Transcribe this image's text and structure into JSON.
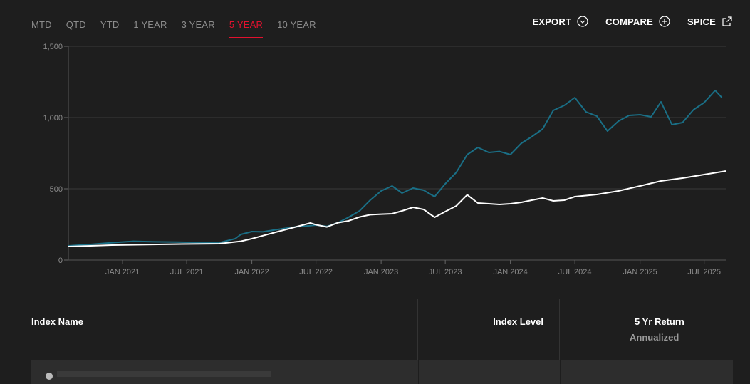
{
  "tabs": [
    {
      "label": "MTD",
      "active": false
    },
    {
      "label": "QTD",
      "active": false
    },
    {
      "label": "YTD",
      "active": false
    },
    {
      "label": "1 YEAR",
      "active": false
    },
    {
      "label": "3 YEAR",
      "active": false
    },
    {
      "label": "5 YEAR",
      "active": true
    },
    {
      "label": "10 YEAR",
      "active": false
    }
  ],
  "actions": {
    "export_label": "EXPORT",
    "export_icon": "chevron-down-circle-icon",
    "compare_label": "COMPARE",
    "compare_icon": "plus-circle-icon",
    "spice_label": "SPICE",
    "spice_icon": "external-link-icon"
  },
  "colors": {
    "accent": "#e1112e",
    "series_teal": "#1a6f86",
    "series_white": "#ffffff",
    "background": "#1e1e1e"
  },
  "table": {
    "col_name": "Index Name",
    "col_level": "Index Level",
    "col_return_line1": "5 Yr Return",
    "col_return_line2": "Annualized"
  },
  "chart_data": {
    "type": "line",
    "xlabel": "",
    "ylabel": "",
    "ylim": [
      0,
      1500
    ],
    "yticks": [
      {
        "value": 0,
        "label": "0"
      },
      {
        "value": 500,
        "label": "500"
      },
      {
        "value": 1000,
        "label": "1,000"
      },
      {
        "value": 1500,
        "label": "1,500"
      }
    ],
    "xlim": [
      "2020-08-01",
      "2025-08-31"
    ],
    "xticks": [
      {
        "date": "2021-01-01",
        "label": "JAN 2021"
      },
      {
        "date": "2021-07-01",
        "label": "JUL 2021"
      },
      {
        "date": "2022-01-01",
        "label": "JAN 2022"
      },
      {
        "date": "2022-07-01",
        "label": "JUL 2022"
      },
      {
        "date": "2023-01-01",
        "label": "JAN 2023"
      },
      {
        "date": "2023-07-01",
        "label": "JUL 2023"
      },
      {
        "date": "2024-01-01",
        "label": "JAN 2024"
      },
      {
        "date": "2024-07-01",
        "label": "JUL 2024"
      },
      {
        "date": "2025-01-01",
        "label": "JAN 2025"
      },
      {
        "date": "2025-07-01",
        "label": "JUL 2025"
      }
    ],
    "grid": true,
    "series": [
      {
        "color": "#1a6f86",
        "points": [
          [
            "2020-08-01",
            100
          ],
          [
            "2020-10-01",
            110
          ],
          [
            "2020-12-01",
            122
          ],
          [
            "2021-02-01",
            132
          ],
          [
            "2021-04-01",
            128
          ],
          [
            "2021-06-01",
            126
          ],
          [
            "2021-08-01",
            124
          ],
          [
            "2021-10-01",
            122
          ],
          [
            "2021-11-15",
            150
          ],
          [
            "2021-12-01",
            180
          ],
          [
            "2022-01-01",
            200
          ],
          [
            "2022-02-01",
            198
          ],
          [
            "2022-03-15",
            215
          ],
          [
            "2022-05-01",
            232
          ],
          [
            "2022-06-01",
            238
          ],
          [
            "2022-07-01",
            245
          ],
          [
            "2022-08-01",
            236
          ],
          [
            "2022-09-01",
            262
          ],
          [
            "2022-10-01",
            300
          ],
          [
            "2022-11-01",
            345
          ],
          [
            "2022-12-01",
            420
          ],
          [
            "2023-01-01",
            485
          ],
          [
            "2023-02-01",
            520
          ],
          [
            "2023-03-01",
            470
          ],
          [
            "2023-04-01",
            505
          ],
          [
            "2023-05-01",
            490
          ],
          [
            "2023-06-01",
            445
          ],
          [
            "2023-07-01",
            535
          ],
          [
            "2023-08-01",
            615
          ],
          [
            "2023-09-01",
            740
          ],
          [
            "2023-10-01",
            790
          ],
          [
            "2023-11-01",
            755
          ],
          [
            "2023-12-01",
            762
          ],
          [
            "2024-01-01",
            740
          ],
          [
            "2024-02-01",
            820
          ],
          [
            "2024-03-01",
            865
          ],
          [
            "2024-04-01",
            920
          ],
          [
            "2024-05-01",
            1050
          ],
          [
            "2024-06-01",
            1085
          ],
          [
            "2024-07-01",
            1140
          ],
          [
            "2024-08-01",
            1040
          ],
          [
            "2024-09-01",
            1010
          ],
          [
            "2024-10-01",
            905
          ],
          [
            "2024-11-01",
            975
          ],
          [
            "2024-12-01",
            1015
          ],
          [
            "2025-01-01",
            1020
          ],
          [
            "2025-02-01",
            1005
          ],
          [
            "2025-03-01",
            1110
          ],
          [
            "2025-04-01",
            950
          ],
          [
            "2025-05-01",
            965
          ],
          [
            "2025-06-01",
            1055
          ],
          [
            "2025-07-01",
            1105
          ],
          [
            "2025-08-01",
            1190
          ],
          [
            "2025-08-20",
            1140
          ]
        ]
      },
      {
        "color": "#ffffff",
        "points": [
          [
            "2020-08-01",
            95
          ],
          [
            "2020-12-01",
            105
          ],
          [
            "2021-06-01",
            112
          ],
          [
            "2021-10-01",
            115
          ],
          [
            "2021-12-01",
            132
          ],
          [
            "2022-01-01",
            150
          ],
          [
            "2022-03-01",
            190
          ],
          [
            "2022-05-01",
            230
          ],
          [
            "2022-06-15",
            260
          ],
          [
            "2022-07-01",
            248
          ],
          [
            "2022-08-01",
            232
          ],
          [
            "2022-09-01",
            262
          ],
          [
            "2022-10-01",
            275
          ],
          [
            "2022-11-01",
            302
          ],
          [
            "2022-12-01",
            318
          ],
          [
            "2023-01-01",
            322
          ],
          [
            "2023-02-01",
            325
          ],
          [
            "2023-03-01",
            345
          ],
          [
            "2023-04-01",
            370
          ],
          [
            "2023-05-01",
            355
          ],
          [
            "2023-06-01",
            300
          ],
          [
            "2023-07-01",
            340
          ],
          [
            "2023-08-01",
            380
          ],
          [
            "2023-09-01",
            458
          ],
          [
            "2023-10-01",
            400
          ],
          [
            "2023-11-01",
            395
          ],
          [
            "2023-12-01",
            390
          ],
          [
            "2024-01-01",
            395
          ],
          [
            "2024-02-01",
            405
          ],
          [
            "2024-03-01",
            420
          ],
          [
            "2024-04-01",
            435
          ],
          [
            "2024-05-01",
            415
          ],
          [
            "2024-06-01",
            420
          ],
          [
            "2024-07-01",
            445
          ],
          [
            "2024-09-01",
            460
          ],
          [
            "2024-11-01",
            485
          ],
          [
            "2025-01-01",
            520
          ],
          [
            "2025-03-01",
            555
          ],
          [
            "2025-05-01",
            575
          ],
          [
            "2025-07-01",
            600
          ],
          [
            "2025-08-31",
            625
          ]
        ]
      }
    ]
  }
}
